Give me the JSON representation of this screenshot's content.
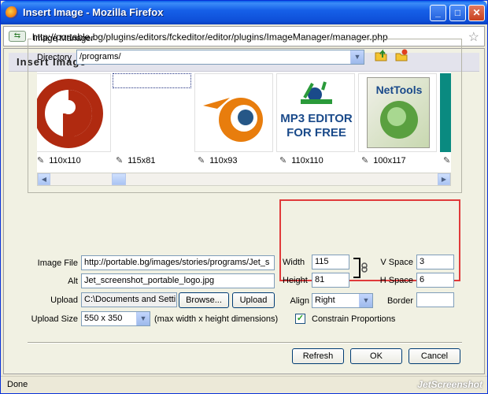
{
  "window": {
    "title": "Insert Image - Mozilla Firefox"
  },
  "browser": {
    "url": "http://portable.bg/plugins/editors/fckeditor/editor/plugins/ImageManager/manager.php"
  },
  "dialog": {
    "heading": "Insert Image"
  },
  "image_manager": {
    "legend": "Image Manager",
    "directory_label": "Directory",
    "directory_value": "/programs/",
    "thumbnails": [
      {
        "name": "red-logo",
        "size": "110x110"
      },
      {
        "name": "orange-swirl",
        "size": "115x81"
      },
      {
        "name": "blender-logo",
        "size": "110x93"
      },
      {
        "name": "mp3-editor",
        "size": "110x110",
        "caption": "MP3 EDITOR FOR FREE"
      },
      {
        "name": "nettools",
        "size": "100x117",
        "caption": "NetTools"
      }
    ]
  },
  "form": {
    "image_file_label": "Image File",
    "image_file_value": "http://portable.bg/images/stories/programs/Jet_s",
    "alt_label": "Alt",
    "alt_value": "Jet_screenshot_portable_logo.jpg",
    "upload_label": "Upload",
    "upload_value": "C:\\Documents and Setti",
    "browse_label": "Browse...",
    "upload_button_label": "Upload",
    "upload_size_label": "Upload Size",
    "upload_size_value": "550 x 350",
    "upload_size_hint": "(max width x height dimensions)"
  },
  "props": {
    "width_label": "Width",
    "width_value": "115",
    "height_label": "Height",
    "height_value": "81",
    "align_label": "Align",
    "align_value": "Right",
    "vspace_label": "V Space",
    "vspace_value": "3",
    "hspace_label": "H Space",
    "hspace_value": "6",
    "border_label": "Border",
    "border_value": "",
    "constrain_label": "Constrain Proportions",
    "constrain_checked": true
  },
  "buttons": {
    "refresh": "Refresh",
    "ok": "OK",
    "cancel": "Cancel"
  },
  "status": {
    "text": "Done",
    "watermark": "JetScreenshot"
  },
  "colors": {
    "titlebar": "#0a55e0",
    "highlight_border": "#e03a3a"
  }
}
